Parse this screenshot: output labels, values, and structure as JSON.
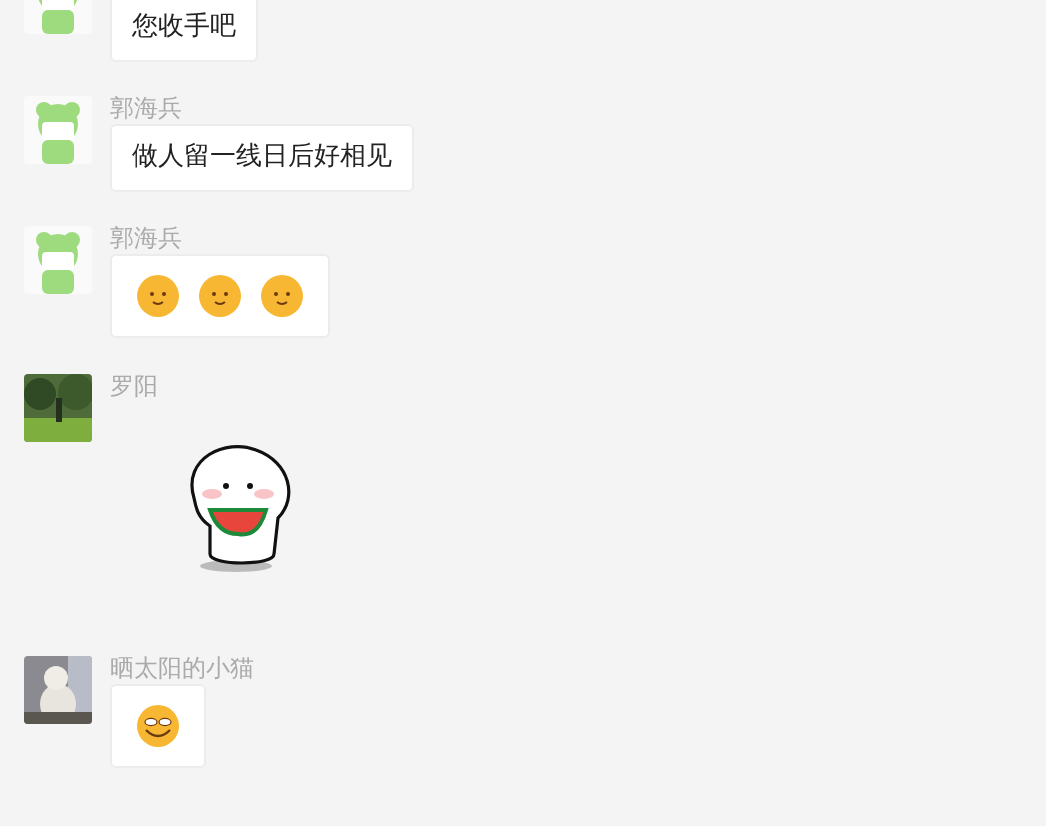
{
  "messages": [
    {
      "avatar": {
        "kind": "cartoon"
      },
      "kind": "text",
      "text": "您收手吧"
    },
    {
      "sender": "郭海兵",
      "avatar": {
        "kind": "cartoon"
      },
      "kind": "text",
      "text": "做人留一线日后好相见"
    },
    {
      "sender": "郭海兵",
      "avatar": {
        "kind": "cartoon"
      },
      "kind": "emoji",
      "emojis": [
        {
          "kind": "blush"
        },
        {
          "kind": "blush"
        },
        {
          "kind": "blush"
        }
      ]
    },
    {
      "sender": "罗阳",
      "avatar": {
        "kind": "park"
      },
      "kind": "sticker"
    },
    {
      "sender": "晒太阳的小猫",
      "avatar": {
        "kind": "pet"
      },
      "kind": "emoji",
      "emojis": [
        {
          "kind": "grin"
        }
      ]
    }
  ]
}
